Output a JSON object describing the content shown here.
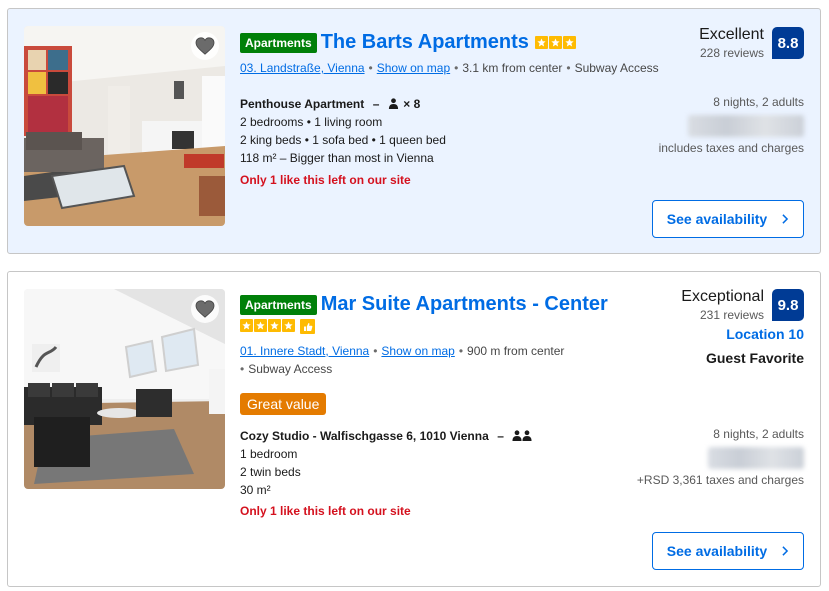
{
  "listings": [
    {
      "type_badge": "Apartments",
      "name": "The Barts Apartments",
      "star_count": 3,
      "district": "03. Landstraße, Vienna",
      "map_link": "Show on map",
      "distance": "3.1 km from center",
      "transit": "Subway Access",
      "room_name": "Penthouse Apartment",
      "room_dash": "–",
      "occupancy": "× 8",
      "details": [
        "2 bedrooms • 1 living room",
        "2 king beds • 1 sofa bed • 1 queen bed",
        "118 m² – Bigger than most in Vienna"
      ],
      "scarcity": "Only 1 like this left on our site",
      "score_word": "Excellent",
      "reviews": "228 reviews",
      "score": "8.8",
      "stay": "8 nights, 2 adults",
      "taxes": "includes taxes and charges",
      "cta": "See availability"
    },
    {
      "type_badge": "Apartments",
      "name": "Mar Suite Apartments - Center",
      "star_count": 4,
      "district": "01. Innere Stadt, Vienna",
      "map_link": "Show on map",
      "distance": "900 m from center",
      "transit": "Subway Access",
      "deal_badge": "Great value",
      "room_name": "Cozy Studio - Walfischgasse 6, 1010 Vienna",
      "room_dash": "–",
      "details": [
        "1 bedroom",
        "2 twin beds",
        "30 m²"
      ],
      "scarcity": "Only 1 like this left on our site",
      "score_word": "Exceptional",
      "reviews": "231 reviews",
      "score": "9.8",
      "location_score": "Location 10",
      "guest_favorite": "Guest Favorite",
      "stay": "8 nights, 2 adults",
      "taxes": "+RSD 3,361 taxes and charges",
      "cta": "See availability"
    }
  ],
  "colors": {
    "brand_blue": "#006ce4",
    "score_blue": "#003b95",
    "green": "#008009",
    "star_yellow": "#febb02",
    "scarcity_red": "#d4111e",
    "great_value_orange": "#e47b00"
  },
  "icons": [
    "heart-icon",
    "person-icon",
    "star-icon",
    "thumbs-up-icon",
    "chevron-right-icon"
  ]
}
